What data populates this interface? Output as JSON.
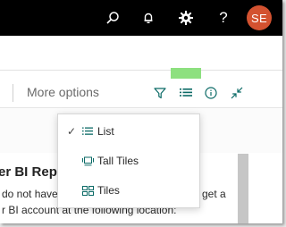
{
  "app_bar": {
    "icons": [
      "search-icon",
      "bell-icon",
      "gear-icon",
      "help-icon"
    ],
    "help_glyph": "?",
    "avatar_initials": "SE",
    "avatar_color": "#d35230"
  },
  "toolbar": {
    "more_options_label": "More options",
    "icons": [
      "filter-icon",
      "list-view-icon",
      "info-icon",
      "collapse-icon"
    ],
    "accent_color": "#0b6a66",
    "highlight_color": "#8de07f"
  },
  "view_menu": {
    "items": [
      {
        "label": "List",
        "icon": "list-icon",
        "selected": true,
        "check": "✓"
      },
      {
        "label": "Tall Tiles",
        "icon": "tall-tiles-icon",
        "selected": false,
        "check": ""
      },
      {
        "label": "Tiles",
        "icon": "tiles-icon",
        "selected": false,
        "check": ""
      }
    ]
  },
  "page": {
    "title_fragment": "er BI Rep",
    "line1_left": "do not have",
    "line1_right": "get a",
    "line2": "r BI account at the following location:"
  }
}
